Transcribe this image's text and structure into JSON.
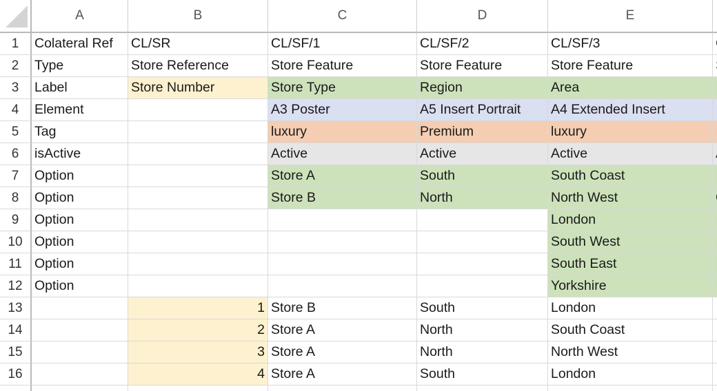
{
  "spreadsheet": {
    "columns": [
      {
        "label": "A"
      },
      {
        "label": "B"
      },
      {
        "label": "C"
      },
      {
        "label": "D"
      },
      {
        "label": "E"
      },
      {
        "label": ""
      }
    ],
    "rows": [
      {
        "number": "1",
        "cells": [
          "Colateral Ref",
          "CL/SR",
          "CL/SF/1",
          "CL/SF/2",
          "CL/SF/3",
          "C"
        ]
      },
      {
        "number": "2",
        "cells": [
          "Type",
          "Store Reference",
          "Store Feature",
          "Store Feature",
          "Store Feature",
          "S"
        ]
      },
      {
        "number": "3",
        "cells": [
          "Label",
          "Store Number",
          "Store Type",
          "Region",
          "Area",
          ""
        ]
      },
      {
        "number": "4",
        "cells": [
          "Element",
          "",
          "A3 Poster",
          "A5 Insert Portrait",
          "A4 Extended Insert",
          ""
        ]
      },
      {
        "number": "5",
        "cells": [
          "Tag",
          "",
          "luxury",
          "Premium",
          "luxury",
          ""
        ]
      },
      {
        "number": "6",
        "cells": [
          "isActive",
          "",
          "Active",
          "Active",
          "Active",
          "A"
        ]
      },
      {
        "number": "7",
        "cells": [
          "Option",
          "",
          "Store A",
          "South",
          "South Coast",
          ""
        ]
      },
      {
        "number": "8",
        "cells": [
          "Option",
          "",
          "Store B",
          "North",
          "North West",
          "C"
        ]
      },
      {
        "number": "9",
        "cells": [
          "Option",
          "",
          "",
          "",
          "London",
          ""
        ]
      },
      {
        "number": "10",
        "cells": [
          "Option",
          "",
          "",
          "",
          "South West",
          ""
        ]
      },
      {
        "number": "11",
        "cells": [
          "Option",
          "",
          "",
          "",
          "South East",
          ""
        ]
      },
      {
        "number": "12",
        "cells": [
          "Option",
          "",
          "",
          "",
          "Yorkshire",
          ""
        ]
      },
      {
        "number": "13",
        "cells": [
          "",
          "1",
          "Store B",
          "South",
          "London",
          ""
        ]
      },
      {
        "number": "14",
        "cells": [
          "",
          "2",
          "Store A",
          "North",
          "South Coast",
          ""
        ]
      },
      {
        "number": "15",
        "cells": [
          "",
          "3",
          "Store A",
          "North",
          "North West",
          ""
        ]
      },
      {
        "number": "16",
        "cells": [
          "",
          "4",
          "Store A",
          "South",
          "London",
          ""
        ]
      },
      {
        "number": "",
        "cells": [
          "",
          "",
          "",
          "",
          "",
          ""
        ]
      }
    ],
    "colors": {
      "yellow": "#fdf1cf",
      "green": "#cde2bb",
      "blue": "#dadff1",
      "orange": "#f4cdb2",
      "gray": "#e6e6e6"
    },
    "cell_fills": [
      {
        "row": 3,
        "cols": [
          1
        ],
        "color": "yellow"
      },
      {
        "row": 3,
        "cols": [
          2,
          3,
          4,
          5
        ],
        "color": "green"
      },
      {
        "row": 4,
        "cols": [
          2,
          3,
          4,
          5
        ],
        "color": "blue"
      },
      {
        "row": 5,
        "cols": [
          2,
          3,
          4,
          5
        ],
        "color": "orange"
      },
      {
        "row": 6,
        "cols": [
          2,
          3,
          4,
          5
        ],
        "color": "gray"
      },
      {
        "row": 7,
        "cols": [
          2,
          3,
          4,
          5
        ],
        "color": "green"
      },
      {
        "row": 8,
        "cols": [
          2,
          3,
          4,
          5
        ],
        "color": "green"
      },
      {
        "row": 9,
        "cols": [
          4,
          5
        ],
        "color": "green"
      },
      {
        "row": 10,
        "cols": [
          4,
          5
        ],
        "color": "green"
      },
      {
        "row": 11,
        "cols": [
          4,
          5
        ],
        "color": "green"
      },
      {
        "row": 12,
        "cols": [
          4,
          5
        ],
        "color": "green"
      },
      {
        "row": 13,
        "cols": [
          1
        ],
        "color": "yellow"
      },
      {
        "row": 14,
        "cols": [
          1
        ],
        "color": "yellow"
      },
      {
        "row": 15,
        "cols": [
          1
        ],
        "color": "yellow"
      },
      {
        "row": 16,
        "cols": [
          1
        ],
        "color": "yellow"
      }
    ],
    "numeric_cells": [
      {
        "row": 13,
        "col": 1
      },
      {
        "row": 14,
        "col": 1
      },
      {
        "row": 15,
        "col": 1
      },
      {
        "row": 16,
        "col": 1
      }
    ]
  }
}
